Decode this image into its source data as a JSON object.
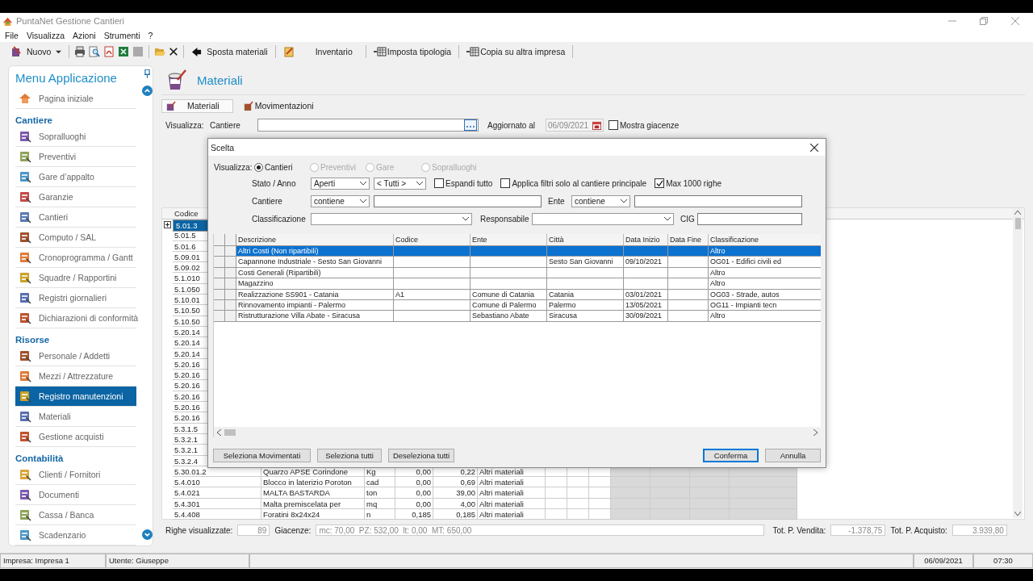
{
  "window": {
    "title": "PuntaNet Gestione Cantieri"
  },
  "menu": [
    "File",
    "Visualizza",
    "Azioni",
    "Strumenti",
    "?"
  ],
  "toolbar": {
    "new_button": "Nuovo",
    "buttons": [
      "Sposta materiali",
      "Inventario",
      "Imposta tipologia",
      "Copia su altra impresa"
    ]
  },
  "sidebar": {
    "title": "Menu Applicazione",
    "groups": [
      {
        "items": [
          {
            "label": "Pagina iniziale",
            "selected": false
          }
        ]
      },
      {
        "heading": "Cantiere",
        "items": [
          {
            "label": "Sopralluoghi",
            "selected": false
          },
          {
            "label": "Preventivi",
            "selected": false
          },
          {
            "label": "Gare d’appalto",
            "selected": false
          },
          {
            "label": "Garanzie",
            "selected": false
          },
          {
            "label": "Cantieri",
            "selected": false
          },
          {
            "label": "Computo / SAL",
            "selected": false
          },
          {
            "label": "Cronoprogramma / Gantt",
            "selected": false
          },
          {
            "label": "Squadre / Rapportini",
            "selected": false
          },
          {
            "label": "Registri giornalieri",
            "selected": false
          },
          {
            "label": "Dichiarazioni di conformità",
            "selected": false
          }
        ]
      },
      {
        "heading": "Risorse",
        "items": [
          {
            "label": "Personale / Addetti",
            "selected": false
          },
          {
            "label": "Mezzi / Attrezzature",
            "selected": false
          },
          {
            "label": "Registro manutenzioni",
            "selected": true
          },
          {
            "label": "Materiali",
            "selected": false
          },
          {
            "label": "Gestione acquisti",
            "selected": false
          }
        ]
      },
      {
        "heading": "Contabilità",
        "items": [
          {
            "label": "Clienti / Fornitori",
            "selected": false
          },
          {
            "label": "Documenti",
            "selected": false
          },
          {
            "label": "Cassa / Banca",
            "selected": false
          },
          {
            "label": "Scadenzario",
            "selected": false
          }
        ]
      }
    ]
  },
  "page": {
    "title": "Materiali",
    "tabs": [
      {
        "label": "Materiali",
        "selected": true
      },
      {
        "label": "Movimentazioni",
        "selected": false
      }
    ],
    "filter": {
      "label": "Visualizza:",
      "field_label": "Cantiere",
      "date_label": "Aggiornato al",
      "date": "06/09/2021",
      "show_stock": {
        "label": "Mostra giacenze",
        "checked": false
      }
    }
  },
  "table": {
    "columns": [
      "Codice"
    ],
    "rows": [
      {
        "code": "5.01.3",
        "selected": true
      },
      {
        "code": "5.01.5",
        "selected": false
      },
      {
        "code": "5.01.6",
        "selected": false
      },
      {
        "code": "5.09.01",
        "selected": false
      },
      {
        "code": "5.09.02",
        "selected": false
      },
      {
        "code": "5.1.010",
        "selected": false
      },
      {
        "code": "5.1.050",
        "selected": false
      },
      {
        "code": "5.10.01",
        "selected": false
      },
      {
        "code": "5.10.50",
        "selected": false
      },
      {
        "code": "5.10.50",
        "selected": false
      },
      {
        "code": "5.20.14",
        "selected": false
      },
      {
        "code": "5.20.14",
        "selected": false
      },
      {
        "code": "5.20.14",
        "selected": false
      },
      {
        "code": "5.20.16",
        "selected": false
      },
      {
        "code": "5.20.16",
        "selected": false
      },
      {
        "code": "5.20.16",
        "selected": false
      },
      {
        "code": "5.20.16",
        "selected": false
      },
      {
        "code": "5.20.16",
        "selected": false
      },
      {
        "code": "5.20.16",
        "selected": false
      },
      {
        "code": "5.3.1.5",
        "selected": false
      },
      {
        "code": "5.3.2.1",
        "selected": false
      },
      {
        "code": "5.3.2.1",
        "selected": false
      },
      {
        "code": "5.3.2.4",
        "selected": false
      },
      {
        "code": "5.30.01.2",
        "description": "Quarzo APSE Corindone",
        "unit": "Kg",
        "qty": "0,00",
        "price": "0,22",
        "category": "Altri materiali",
        "selected": false
      },
      {
        "code": "5.4.010",
        "description": "Blocco in laterizio Poroton",
        "unit": "cad",
        "qty": "0,00",
        "price": "0,69",
        "category": "Altri materiali",
        "selected": false
      },
      {
        "code": "5.4.021",
        "description": "MALTA BASTARDA",
        "unit": "ton",
        "qty": "0,00",
        "price": "39,00",
        "category": "Altri materiali",
        "selected": false
      },
      {
        "code": "5.4.301",
        "description": "Malta premiscelata per",
        "unit": "mq",
        "qty": "0,00",
        "price": "4,00",
        "category": "Altri materiali",
        "selected": false
      },
      {
        "code": "5.4.408",
        "description": "Foratini 8x24x24",
        "unit": "n",
        "qty": "0,185",
        "price": "0,185",
        "category": "Altri materiali",
        "selected": false
      }
    ]
  },
  "footer": {
    "rows_label": "Righe visualizzate:",
    "rows_count": "89",
    "stock_label": "Giacenze:",
    "stock": "mc: 70,00  PZ: 532,00  lt: 0,00  MT: 650,00",
    "sale_label": "Tot. P. Vendita:",
    "sale": "-1.378,75",
    "purchase_label": "Tot. P. Acquisto:",
    "purchase": "3.939,80"
  },
  "status_bar": {
    "company": "Impresa: Impresa 1",
    "user": "Utente: Giuseppe",
    "date": "06/09/2021",
    "time": "07:30"
  },
  "dialog": {
    "title": "Scelta",
    "view_label": "Visualizza:",
    "views": [
      {
        "label": "Cantieri",
        "selected": true,
        "disabled": false
      },
      {
        "label": "Preventivi",
        "selected": false,
        "disabled": true
      },
      {
        "label": "Gare",
        "selected": false,
        "disabled": true
      },
      {
        "label": "Sopralluoghi",
        "selected": false,
        "disabled": true
      }
    ],
    "state_label": "Stato / Anno",
    "state": "Aperti",
    "year": "< Tutti >",
    "options": [
      {
        "label": "Espandi tutto",
        "checked": false
      },
      {
        "label": "Applica filtri solo al cantiere principale",
        "checked": false
      },
      {
        "label": "Max 1000 righe",
        "checked": true
      }
    ],
    "site_label": "Cantiere",
    "site_mode": "contiene",
    "entity_label": "Ente",
    "entity_mode": "contiene",
    "class_label": "Classificazione",
    "manager_label": "Responsabile",
    "cig_label": "CIG",
    "grid": {
      "columns": [
        "Descrizione",
        "Codice",
        "Ente",
        "Città",
        "Data Inizio",
        "Data Fine",
        "Classificazione"
      ],
      "rows": [
        {
          "cells": [
            "Altri Costi (Non ripartibili)",
            "",
            "",
            "",
            "",
            "",
            "Altro"
          ],
          "selected": true
        },
        {
          "cells": [
            "Capannone Industriale - Sesto San Giovanni",
            "",
            "",
            "Sesto San Giovanni",
            "09/10/2021",
            "",
            "OG01 - Edifici civili ed"
          ],
          "selected": false
        },
        {
          "cells": [
            "Costi Generali (Ripartibili)",
            "",
            "",
            "",
            "",
            "",
            "Altro"
          ],
          "selected": false
        },
        {
          "cells": [
            "Magazzino",
            "",
            "",
            "",
            "",
            "",
            "Altro"
          ],
          "selected": false
        },
        {
          "cells": [
            "Realizzazione SS901 - Catania",
            "A1",
            "Comune di Catania",
            "Catania",
            "03/01/2021",
            "",
            "OG03 - Strade, autos"
          ],
          "selected": false
        },
        {
          "cells": [
            "Rinnovamento impianti - Palermo",
            "",
            "Comune di Palermo",
            "Palermo",
            "13/05/2021",
            "",
            "OG11 - Impianti tecn"
          ],
          "selected": false
        },
        {
          "cells": [
            "Ristrutturazione Villa Abate - Siracusa",
            "",
            "Sebastiano Abate",
            "Siracusa",
            "30/09/2021",
            "",
            "Altro"
          ],
          "selected": false
        }
      ]
    },
    "buttons_left": [
      "Seleziona Movimentati",
      "Seleziona tutti",
      "Deseleziona tutti"
    ],
    "buttons_right": [
      {
        "label": "Conferma",
        "default": true
      },
      {
        "label": "Annulla",
        "default": false
      }
    ]
  }
}
